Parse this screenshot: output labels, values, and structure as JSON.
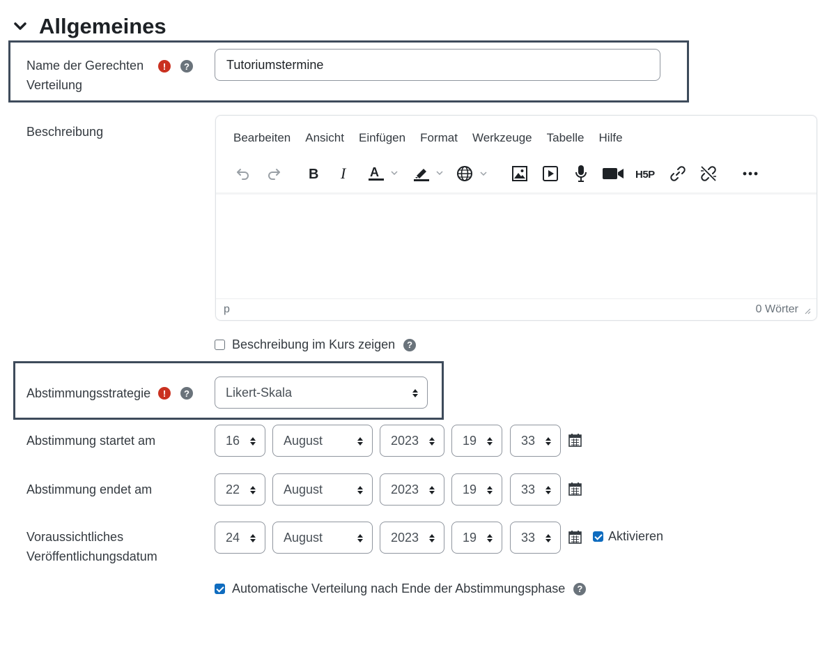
{
  "section": {
    "title": "Allgemeines"
  },
  "name_field": {
    "label_line1": "Name der Gerechten",
    "label_line2": "Verteilung",
    "value": "Tutoriumstermine"
  },
  "description": {
    "label": "Beschreibung",
    "menu": [
      "Bearbeiten",
      "Ansicht",
      "Einfügen",
      "Format",
      "Werkzeuge",
      "Tabelle",
      "Hilfe"
    ],
    "status_path": "p",
    "word_count": "0 Wörter",
    "toolbar_icons": [
      "undo-icon",
      "redo-icon",
      "bold-icon",
      "italic-icon",
      "text-color-icon",
      "highlight-color-icon",
      "language-icon",
      "image-icon",
      "media-icon",
      "record-audio-icon",
      "record-video-icon",
      "h5p-icon",
      "link-icon",
      "unlink-icon",
      "more-icon"
    ]
  },
  "show_description": {
    "label": "Beschreibung im Kurs zeigen",
    "checked": false
  },
  "strategy": {
    "label": "Abstimmungsstrategie",
    "value": "Likert-Skala"
  },
  "start": {
    "label": "Abstimmung startet am",
    "day": "16",
    "month": "August",
    "year": "2023",
    "hour": "19",
    "minute": "33"
  },
  "end": {
    "label": "Abstimmung endet am",
    "day": "22",
    "month": "August",
    "year": "2023",
    "hour": "19",
    "minute": "33"
  },
  "publish": {
    "label_line1": "Voraussichtliches",
    "label_line2": "Veröffentlichungsdatum",
    "day": "24",
    "month": "August",
    "year": "2023",
    "hour": "19",
    "minute": "33",
    "enable_label": "Aktivieren",
    "enabled": true
  },
  "auto_allocation": {
    "label": "Automatische Verteilung nach Ende der Abstimmungsphase",
    "checked": true
  },
  "colors": {
    "error": "#ca3120",
    "help": "#6a737b",
    "checkbox": "#0f6cbf",
    "highlight_border": "#3e4b5b"
  }
}
